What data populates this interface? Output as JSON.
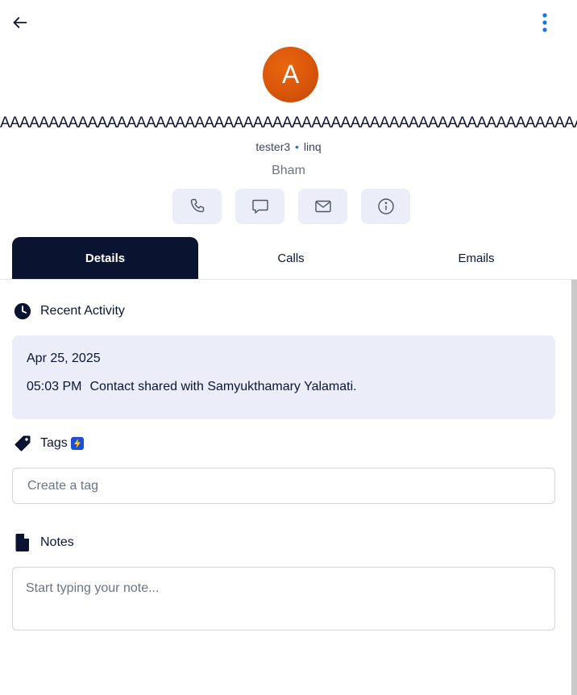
{
  "header": {
    "back_icon": "arrow-left-icon",
    "menu_icon": "more-vertical-icon"
  },
  "contact": {
    "avatar_initial": "A",
    "name": "AAAAAAAAAAAAAAAAAAAAAAAAAAAAAAAAAAAAAAAAAAAAAAAAAAAAAAAAAAAAA",
    "owner": "tester3",
    "separator": "•",
    "source": "linq",
    "company": "Bham"
  },
  "actions": [
    {
      "icon": "phone-icon"
    },
    {
      "icon": "message-icon"
    },
    {
      "icon": "mail-icon"
    },
    {
      "icon": "info-icon"
    }
  ],
  "tabs": [
    {
      "label": "Details",
      "active": true
    },
    {
      "label": "Calls",
      "active": false
    },
    {
      "label": "Emails",
      "active": false
    }
  ],
  "recent_activity": {
    "title": "Recent Activity",
    "date": "Apr 25, 2025",
    "time": "05:03 PM",
    "text": "Contact shared with Samyukthamary Yalamati."
  },
  "tags": {
    "title": "Tags",
    "placeholder": "Create a tag"
  },
  "notes": {
    "title": "Notes",
    "placeholder": "Start typing your note..."
  },
  "colors": {
    "primary_dark": "#0a1330",
    "accent_blue": "#1a73e8",
    "avatar_orange": "#d9560a",
    "action_bg": "#ebeef8"
  }
}
